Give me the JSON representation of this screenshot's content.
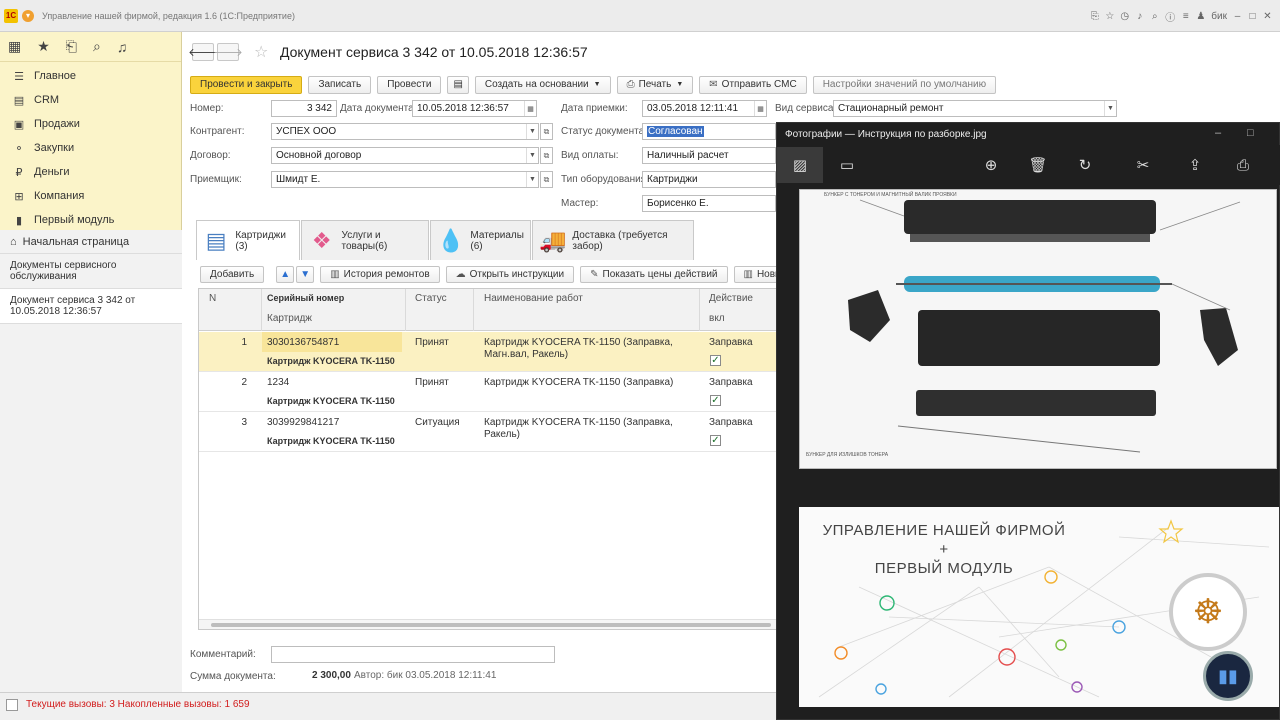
{
  "titlebar": {
    "logo": "1С",
    "title": "Управление нашей фирмой, редакция 1.6 (1С:Предприятие)",
    "user": "бик"
  },
  "sidebar": {
    "items": [
      {
        "label": "Главное",
        "icon": "menu-lines-icon"
      },
      {
        "label": "CRM",
        "icon": "crm-card-icon"
      },
      {
        "label": "Продажи",
        "icon": "sales-icon"
      },
      {
        "label": "Закупки",
        "icon": "purchase-icon"
      },
      {
        "label": "Деньги",
        "icon": "money-icon"
      },
      {
        "label": "Компания",
        "icon": "company-icon"
      },
      {
        "label": "Первый модуль",
        "icon": "module-icon"
      }
    ],
    "home": "Начальная страница",
    "open_docs": [
      "Документы сервисного обслуживания",
      "Документ сервиса 3 342 от 10.05.2018 12:36:57"
    ]
  },
  "form": {
    "title": "Документ сервиса 3 342 от 10.05.2018 12:36:57",
    "commands": {
      "post_close": "Провести и закрыть",
      "save": "Записать",
      "post": "Провести",
      "create_based": "Создать на основании",
      "print": "Печать",
      "send_sms": "Отправить СМС",
      "defaults": "Настройки значений по умолчанию"
    },
    "fields": {
      "number_label": "Номер:",
      "number": "3 342",
      "doc_date_label": "Дата документа:",
      "doc_date": "10.05.2018 12:36:57",
      "accept_date_label": "Дата приемки:",
      "accept_date": "03.05.2018 12:11:41",
      "service_type_label": "Вид сервиса:",
      "service_type": "Стационарный ремонт",
      "counterparty_label": "Контрагент:",
      "counterparty": "УСПЕХ ООО",
      "status_label": "Статус документа:",
      "status": "Согласован",
      "contract_label": "Договор:",
      "contract": "Основной договор",
      "payment_label": "Вид оплаты:",
      "payment": "Наличный расчет",
      "receiver_label": "Приемщик:",
      "receiver": "Шмидт Е.",
      "equipment_label": "Тип оборудования:",
      "equipment": "Картриджи",
      "master_label": "Мастер:",
      "master": "Борисенко Е."
    },
    "tabs": [
      {
        "label": "Картриджи (3)",
        "icon": "cartridge-list-icon"
      },
      {
        "label": "Услуги и товары(6)",
        "icon": "goods-box-icon"
      },
      {
        "label": "Материалы (6)",
        "icon": "ink-drop-icon"
      },
      {
        "label": "Доставка (требуется забор)",
        "icon": "truck-icon"
      }
    ],
    "table_toolbar": {
      "add": "Добавить",
      "history": "История ремонтов",
      "open_instructions": "Открыть инструкции",
      "show_prices": "Показать цены действий",
      "new_barcode": "Новый ШК"
    },
    "table": {
      "headers": {
        "n": "N",
        "serial": "Серийный номер",
        "cartridge": "Картридж",
        "status": "Статус",
        "work": "Наименование работ",
        "action": "Действие",
        "enabled": "вкл"
      },
      "rows": [
        {
          "n": "1",
          "serial": "3030136754871",
          "cartridge": "Картридж KYOCERA TK-1150",
          "status": "Принят",
          "work": "Картридж KYOCERA TK-1150 (Заправка, Магн.вал, Ракель)",
          "action": "Заправка",
          "checked": true
        },
        {
          "n": "2",
          "serial": "1234",
          "cartridge": "Картридж KYOCERA TK-1150",
          "status": "Принят",
          "work": "Картридж KYOCERA TK-1150 (Заправка)",
          "action": "Заправка",
          "checked": true
        },
        {
          "n": "3",
          "serial": "3039929841217",
          "cartridge": "Картридж KYOCERA TK-1150",
          "status": "Ситуация",
          "work": "Картридж KYOCERA TK-1150 (Заправка, Ракель)",
          "action": "Заправка",
          "checked": true
        }
      ]
    },
    "comment_label": "Комментарий:",
    "comment": "",
    "sum_label": "Сумма документа:",
    "sum": "2 300,00",
    "author": "Автор: бик 03.05.2018 12:11:41"
  },
  "statusbar": {
    "text": "Текущие вызовы: 3   Накопленные вызовы: 1 659"
  },
  "viewer": {
    "title": "Фотографии — Инструкция по разборке.jpg",
    "tools": [
      "image-icon",
      "slideshow-icon",
      "zoom-in-icon",
      "delete-icon",
      "rotate-icon",
      "edit-icon",
      "share-icon",
      "print-icon"
    ],
    "photo_caption": "БУНКЕР С ТОНЕРОМ И МАГНИТНЫЙ ВАЛИК ПРОЯВКИ",
    "photo_caption_2": "БУНКЕР ДЛЯ ИЗЛИШКОВ ТОНЕРА",
    "promo_line1": "УПРАВЛЕНИЕ НАШЕЙ ФИРМОЙ",
    "promo_line2": "+",
    "promo_line3": "ПЕРВЫЙ МОДУЛЬ"
  }
}
